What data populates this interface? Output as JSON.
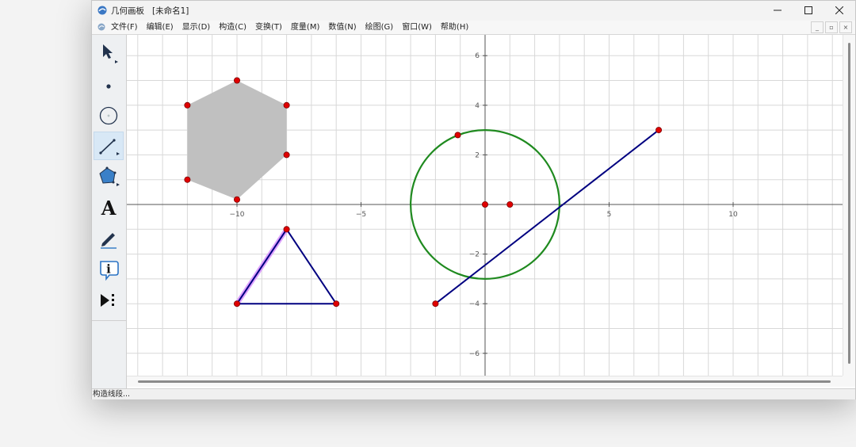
{
  "window": {
    "title": "几何画板   [未命名1]"
  },
  "menu": {
    "items": [
      "文件(F)",
      "编辑(E)",
      "显示(D)",
      "构造(C)",
      "变换(T)",
      "度量(M)",
      "数值(N)",
      "绘图(G)",
      "窗口(W)",
      "帮助(H)"
    ]
  },
  "toolbox": {
    "tools": [
      {
        "name": "arrow-tool",
        "icon": "arrow-icon"
      },
      {
        "name": "point-tool",
        "icon": "point-icon"
      },
      {
        "name": "compass-tool",
        "icon": "circle-icon"
      },
      {
        "name": "straightedge-tool",
        "icon": "line-icon",
        "selected": true
      },
      {
        "name": "polygon-tool",
        "icon": "pentagon-icon"
      },
      {
        "name": "text-tool",
        "icon": "letter-a-icon"
      },
      {
        "name": "marker-tool",
        "icon": "pen-icon"
      },
      {
        "name": "information-tool",
        "icon": "info-icon"
      },
      {
        "name": "custom-tool",
        "icon": "play-icon"
      }
    ],
    "text_tool_glyph": "A",
    "info_tool_glyph": "i"
  },
  "colors": {
    "point": "#e00000",
    "hexagon_fill": "#c0c0c0",
    "circle": "#1f8a1f",
    "segment": "#000080",
    "highlight": "#dda0ff",
    "grid": "#d8d8d8",
    "axis": "#555555"
  },
  "axes": {
    "x_ticks": [
      -10,
      -5,
      5,
      10
    ],
    "x_tick_labels": [
      "−10",
      "−5",
      "5",
      "10"
    ],
    "y_ticks": [
      6,
      4,
      2,
      -2,
      -4,
      -6
    ],
    "y_tick_labels": [
      "6",
      "4",
      "2",
      "−2",
      "−4",
      "−6"
    ]
  },
  "figures": {
    "hexagon": [
      [
        -10,
        5
      ],
      [
        -8,
        4
      ],
      [
        -8,
        2
      ],
      [
        -10,
        0.2
      ],
      [
        -12,
        1
      ],
      [
        -12,
        4
      ]
    ],
    "triangle": {
      "vertices": [
        [
          -8,
          -1
        ],
        [
          -10,
          -4
        ],
        [
          -6,
          -4
        ]
      ],
      "highlighted_side": [
        0,
        1
      ]
    },
    "circle": {
      "center": [
        0,
        0
      ],
      "radius": 3,
      "radius_point": [
        -1.1,
        2.8
      ]
    },
    "circle_extra_point": [
      1,
      0
    ],
    "segment": [
      [
        -2,
        -4
      ],
      [
        7,
        3
      ]
    ]
  },
  "status": {
    "text": "构造线段..."
  }
}
